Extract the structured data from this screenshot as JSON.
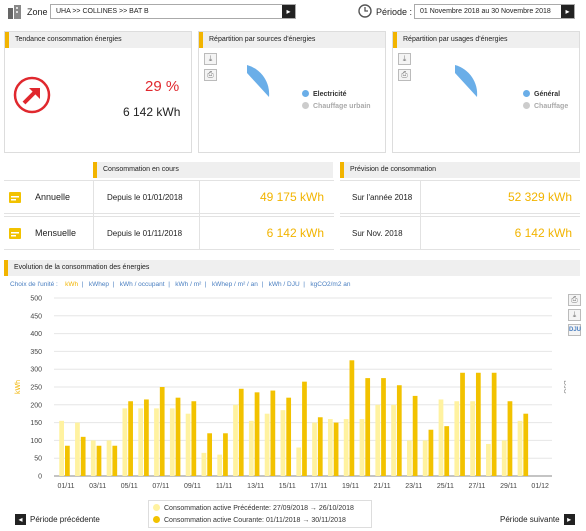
{
  "header": {
    "zone_label": "Zone :",
    "zone_value": "UHA >> COLLINES >> BAT B",
    "period_label": "Période :",
    "period_value": "01 Novembre 2018 au 30 Novembre 2018"
  },
  "trend": {
    "title": "Tendance consommation énergies",
    "percent": "29 %",
    "value": "6 142 kWh"
  },
  "sources": {
    "title": "Répartition par sources d'énergies",
    "items": [
      "Electricité",
      "Chauffage urbain"
    ]
  },
  "usages": {
    "title": "Répartition par usages d'énergies",
    "items": [
      "Général",
      "Chauffage"
    ]
  },
  "current": {
    "title": "Consommation en cours",
    "rows": [
      {
        "label": "Annuelle",
        "since": "Depuis le 01/01/2018",
        "value": "49 175 kWh"
      },
      {
        "label": "Mensuelle",
        "since": "Depuis le 01/11/2018",
        "value": "6 142 kWh"
      }
    ]
  },
  "forecast": {
    "title": "Prévision de consommation",
    "rows": [
      {
        "label": "Sur l'année 2018",
        "value": "52 329 kWh"
      },
      {
        "label": "Sur Nov. 2018",
        "value": "6 142 kWh"
      }
    ]
  },
  "evolution": {
    "title": "Evolution de la consommation des énergies",
    "unit_label": "Choix de l'unité :",
    "units": [
      "kWh",
      "kWhep",
      "kWh / occupant",
      "kWh / m²",
      "kWhep / m² / an",
      "kWh / DJU",
      "kgCO2/m2 an"
    ],
    "side_button": "DJU",
    "prev_button": "Période précédente",
    "next_button": "Période suivante"
  },
  "colors": {
    "accent": "#f2b400",
    "previous": "#fff2a0",
    "current": "#f2c200",
    "red": "#e0282e",
    "blue": "#6aaee8"
  },
  "chart_data": {
    "type": "bar",
    "ylabel": "kWh",
    "y2label": "DJU",
    "ylim": [
      0,
      500
    ],
    "yticks": [
      0,
      50,
      100,
      150,
      200,
      250,
      300,
      350,
      400,
      450,
      500
    ],
    "categories": [
      "01/11",
      "02/11",
      "03/11",
      "04/11",
      "05/11",
      "06/11",
      "07/11",
      "08/11",
      "09/11",
      "10/11",
      "11/11",
      "12/11",
      "13/11",
      "14/11",
      "15/11",
      "16/11",
      "17/11",
      "18/11",
      "19/11",
      "20/11",
      "21/11",
      "22/11",
      "23/11",
      "24/11",
      "25/11",
      "26/11",
      "27/11",
      "28/11",
      "29/11",
      "30/11"
    ],
    "xtick_labels": [
      "01/11",
      "03/11",
      "05/11",
      "07/11",
      "09/11",
      "11/11",
      "13/11",
      "15/11",
      "17/11",
      "19/11",
      "21/11",
      "23/11",
      "25/11",
      "27/11",
      "29/11",
      "01/12"
    ],
    "series": [
      {
        "name": "Consommation active Précédente: 27/09/2018 → 26/10/2018",
        "values": [
          155,
          150,
          100,
          100,
          190,
          190,
          190,
          190,
          175,
          65,
          60,
          200,
          155,
          175,
          185,
          80,
          150,
          160,
          160,
          160,
          200,
          200,
          100,
          100,
          215,
          210,
          210,
          90,
          100,
          155
        ]
      },
      {
        "name": "Consommation active Courante: 01/11/2018 → 30/11/2018",
        "values": [
          85,
          110,
          85,
          85,
          210,
          215,
          250,
          220,
          210,
          120,
          120,
          245,
          235,
          240,
          220,
          265,
          165,
          150,
          325,
          275,
          275,
          255,
          225,
          130,
          140,
          290,
          290,
          290,
          210,
          175
        ]
      }
    ]
  }
}
